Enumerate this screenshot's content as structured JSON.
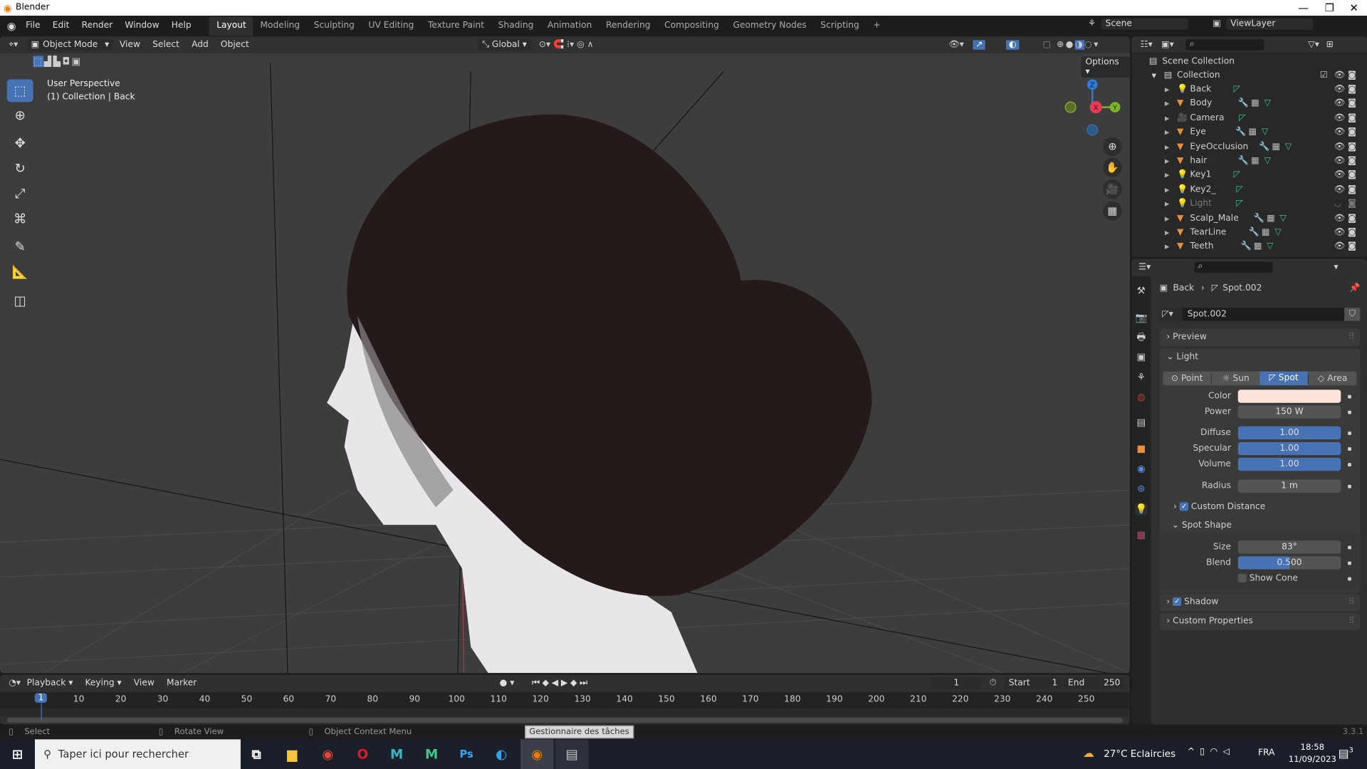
{
  "window": {
    "title": "Blender",
    "minimize": "—",
    "maximize": "❐",
    "close": "✕"
  },
  "menu": [
    "File",
    "Edit",
    "Render",
    "Window",
    "Help"
  ],
  "workspaces": [
    "Layout",
    "Modeling",
    "Sculpting",
    "UV Editing",
    "Texture Paint",
    "Shading",
    "Animation",
    "Rendering",
    "Compositing",
    "Geometry Nodes",
    "Scripting",
    "+"
  ],
  "scene": {
    "name": "Scene",
    "view_layer": "ViewLayer"
  },
  "viewport": {
    "mode": "Object Mode",
    "menus": [
      "View",
      "Select",
      "Add",
      "Object"
    ],
    "orientation": "Global",
    "options": "Options",
    "info_line1": "User Perspective",
    "info_line2": "(1) Collection | Back",
    "gizmo": {
      "x": "X",
      "y": "Y",
      "z": "Z"
    }
  },
  "outliner": {
    "root": "Scene Collection",
    "collection": "Collection",
    "items": [
      {
        "name": "Back",
        "type": "light"
      },
      {
        "name": "Body",
        "type": "mesh"
      },
      {
        "name": "Camera",
        "type": "camera"
      },
      {
        "name": "Eye",
        "type": "mesh"
      },
      {
        "name": "EyeOcclusion",
        "type": "mesh"
      },
      {
        "name": "hair",
        "type": "mesh"
      },
      {
        "name": "Key1",
        "type": "light"
      },
      {
        "name": "Key2_",
        "type": "light"
      },
      {
        "name": "Light",
        "type": "light",
        "hidden": true
      },
      {
        "name": "Scalp_Male",
        "type": "mesh"
      },
      {
        "name": "TearLine",
        "type": "mesh"
      },
      {
        "name": "Teeth",
        "type": "mesh"
      }
    ]
  },
  "properties": {
    "breadcrumb": {
      "object": "Back",
      "data": "Spot.002"
    },
    "datablock": "Spot.002",
    "preview": "Preview",
    "light": "Light",
    "light_types": [
      "Point",
      "Sun",
      "Spot",
      "Area"
    ],
    "active_type": "Spot",
    "color_label": "Color",
    "color": "#fde4dc",
    "power_label": "Power",
    "power": "150 W",
    "diffuse_label": "Diffuse",
    "diffuse": "1.00",
    "specular_label": "Specular",
    "specular": "1.00",
    "volume_label": "Volume",
    "volume": "1.00",
    "radius_label": "Radius",
    "radius": "1 m",
    "custom_distance": "Custom Distance",
    "spot_shape": "Spot Shape",
    "size_label": "Size",
    "size": "83°",
    "blend_label": "Blend",
    "blend": "0.500",
    "blend_fraction": 0.5,
    "show_cone": "Show Cone",
    "shadow": "Shadow",
    "custom_properties": "Custom Properties"
  },
  "timeline": {
    "menus": [
      "Playback",
      "Keying",
      "View",
      "Marker"
    ],
    "current_frame": "1",
    "start_label": "Start",
    "start": "1",
    "end_label": "End",
    "end": "250",
    "ticks": [
      "1",
      "10",
      "20",
      "30",
      "40",
      "50",
      "60",
      "70",
      "80",
      "90",
      "100",
      "110",
      "120",
      "130",
      "140",
      "150",
      "160",
      "170",
      "180",
      "190",
      "200",
      "210",
      "220",
      "230",
      "240",
      "250"
    ]
  },
  "status": {
    "select": "Select",
    "rotate": "Rotate View",
    "context": "Object Context Menu",
    "tooltip": "Gestionnaire des tâches",
    "version": "3.3.1"
  },
  "taskbar": {
    "search_placeholder": "Taper ici pour rechercher",
    "weather": "27°C  Eclaircies",
    "lang": "FRA",
    "time": "18:58",
    "date": "11/09/2023",
    "notifications": "3"
  },
  "colors": {
    "accent": "#4772b3",
    "viewport_bg": "#3d3d3d",
    "panel": "#303030"
  }
}
